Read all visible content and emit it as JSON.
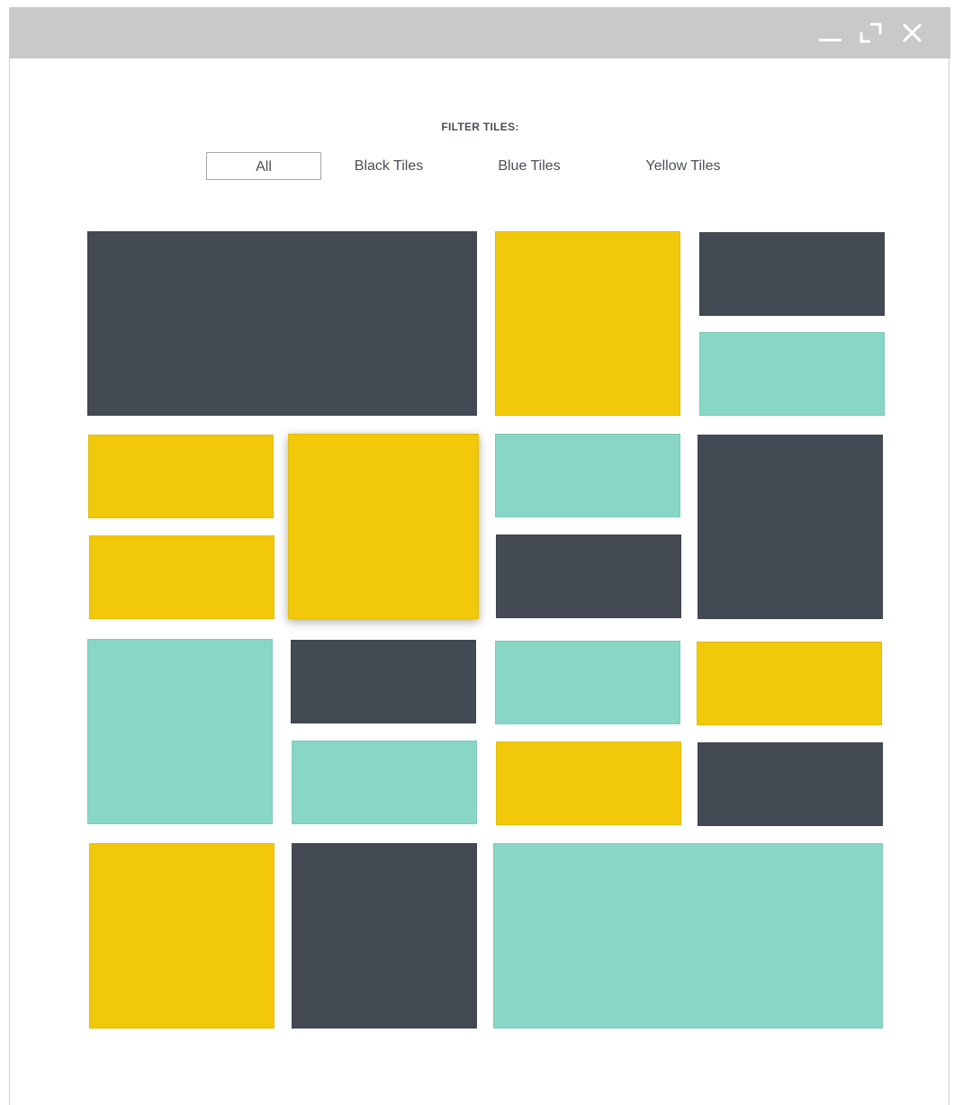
{
  "window": {
    "minimize_icon": "minimize-icon",
    "maximize_icon": "maximize-icon",
    "close_icon": "close-icon"
  },
  "filter": {
    "title": "FILTER TILES:",
    "options": [
      {
        "label": "All",
        "active": true
      },
      {
        "label": "Black Tiles",
        "active": false
      },
      {
        "label": "Blue Tiles",
        "active": false
      },
      {
        "label": "Yellow Tiles",
        "active": false
      }
    ]
  },
  "colors": {
    "black": "#434a54",
    "blue": "#88d6c5",
    "yellow": "#f2c80a",
    "titlebar": "#c9c9c9",
    "text": "#4a4f57"
  },
  "tiles": [
    {
      "color": "black"
    },
    {
      "color": "yellow"
    },
    {
      "color": "black"
    },
    {
      "color": "blue"
    },
    {
      "color": "yellow"
    },
    {
      "color": "yellow",
      "hovered": true
    },
    {
      "color": "blue"
    },
    {
      "color": "black"
    },
    {
      "color": "yellow"
    },
    {
      "color": "black"
    },
    {
      "color": "blue"
    },
    {
      "color": "black"
    },
    {
      "color": "blue"
    },
    {
      "color": "yellow"
    },
    {
      "color": "blue"
    },
    {
      "color": "yellow"
    },
    {
      "color": "black"
    },
    {
      "color": "yellow"
    },
    {
      "color": "black"
    },
    {
      "color": "blue"
    }
  ]
}
